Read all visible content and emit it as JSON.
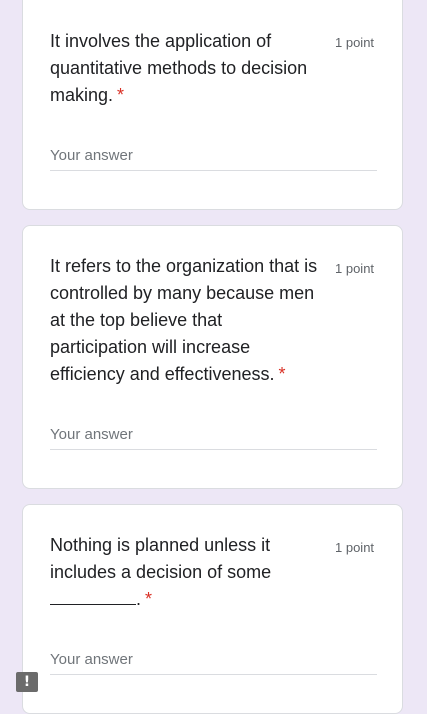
{
  "questions": [
    {
      "text": "It involves the application of quantitative methods to decision making.",
      "required_mark": "*",
      "points": "1 point",
      "answer_placeholder": "Your answer"
    },
    {
      "text": "It refers to the organization that is controlled by many because men at the top believe that participation will increase efficiency and effectiveness.",
      "required_mark": "*",
      "points": "1 point",
      "answer_placeholder": "Your answer"
    },
    {
      "text": "Nothing is planned unless it includes a decision of some",
      "suffix": ".",
      "required_mark": "*",
      "points": "1 point",
      "answer_placeholder": "Your answer"
    }
  ],
  "feedback": {
    "icon": "!"
  },
  "colors": {
    "background": "#ede7f6",
    "required": "#d93025"
  }
}
